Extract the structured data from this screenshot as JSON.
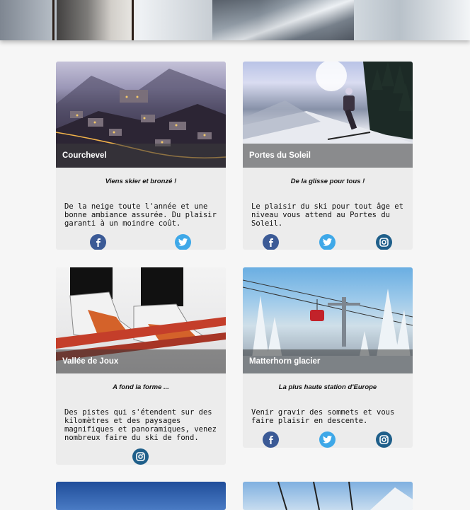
{
  "cards": [
    {
      "title": "Courchevel",
      "tagline": "Viens skier et bronzé !",
      "description": "De la neige toute l'année et une bonne ambiance assurée. Du plaisir garanti à un moindre coût.",
      "socials": [
        "facebook-icon",
        "twitter-icon"
      ]
    },
    {
      "title": "Portes du Soleil",
      "tagline": "De la glisse pour tous !",
      "description": "Le plaisir du ski pour tout âge et niveau vous attend au Portes du Soleil.",
      "socials": [
        "facebook-icon",
        "twitter-icon",
        "instagram-icon"
      ]
    },
    {
      "title": "Vallée de Joux",
      "tagline": "A fond la forme ...",
      "description": "Des pistes qui s'étendent sur des kilomètres et des paysages magnifiques et panoramiques, venez nombreux faire du ski de fond.",
      "socials": [
        "instagram-icon"
      ]
    },
    {
      "title": "Matterhorn glacier",
      "tagline": "La plus haute station d'Europe",
      "description": "Venir gravir des sommets et vous faire plaisir en descente.",
      "socials": [
        "facebook-icon",
        "twitter-icon",
        "instagram-icon"
      ]
    }
  ],
  "colors": {
    "facebook": "#3b5a96",
    "twitter": "#3ea8e8",
    "instagram": "#1f5f8a",
    "caption_overlay": "#3c3c3c",
    "card_bg": "#ececec",
    "page_bg": "#f6f6f6"
  }
}
